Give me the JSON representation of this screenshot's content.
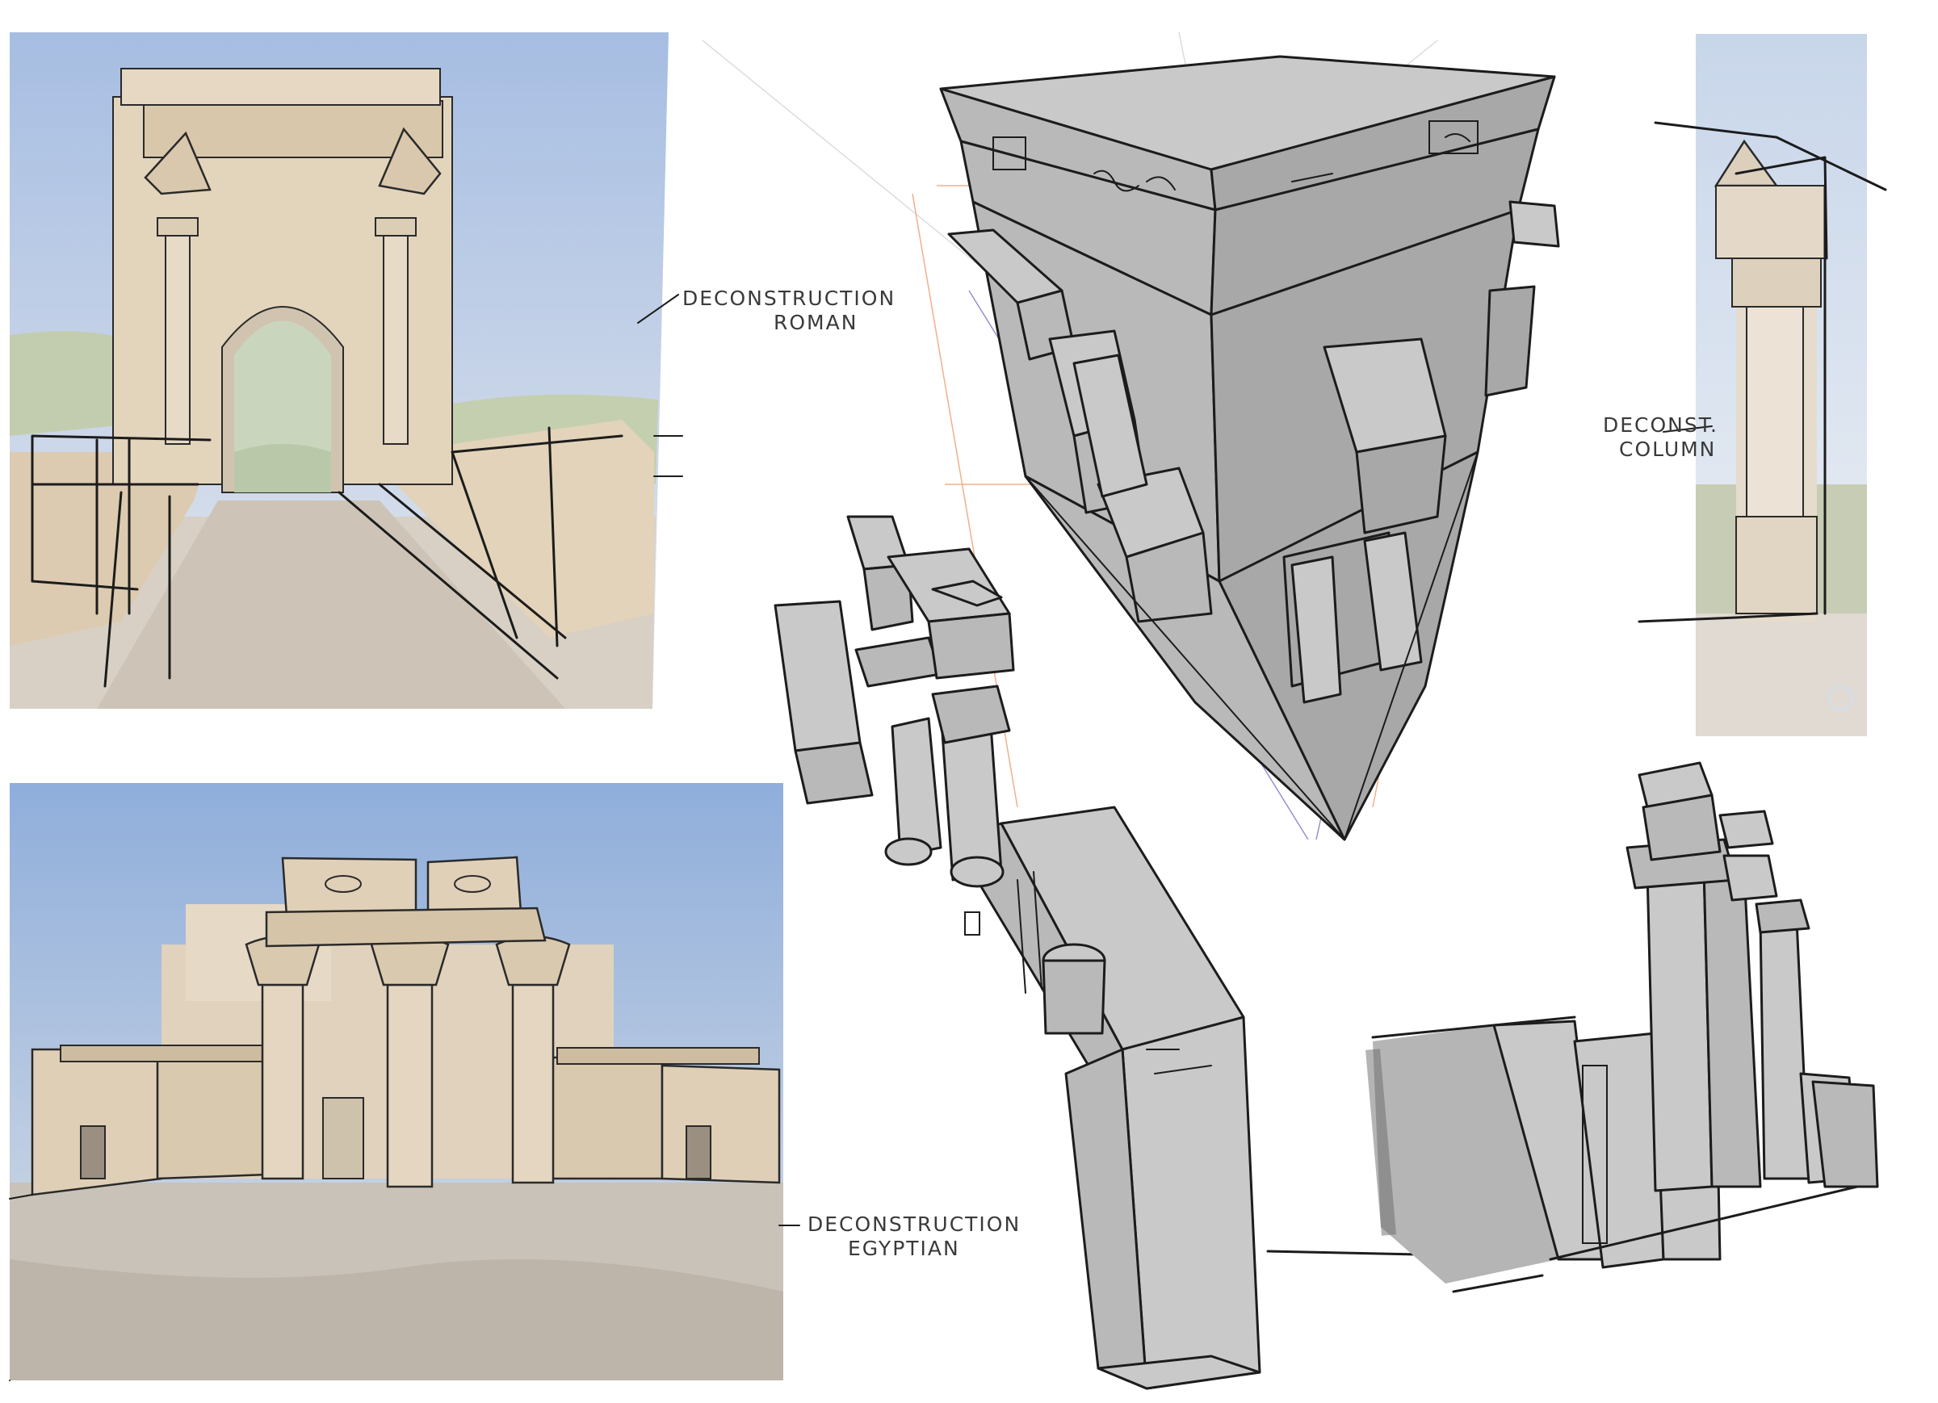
{
  "annotations": {
    "roman": [
      "DECONSTRUCTION",
      "ROMAN"
    ],
    "column": [
      "DECONST.",
      "COLUMN"
    ],
    "egyptian": [
      "DECONSTRUCTION",
      "EGYPTIAN"
    ]
  },
  "colors": {
    "sky_top": "#9db6e0",
    "sky_bottom": "#dfe5ee",
    "stone": "#dcc9ac",
    "stone_dark": "#c1a98a",
    "ground": "#cfc5b8",
    "sketch_fill": "#b9b9b9",
    "ink": "#1c1c1c",
    "guide_orange": "#f0b08a",
    "guide_purple": "#9a8fd0"
  }
}
